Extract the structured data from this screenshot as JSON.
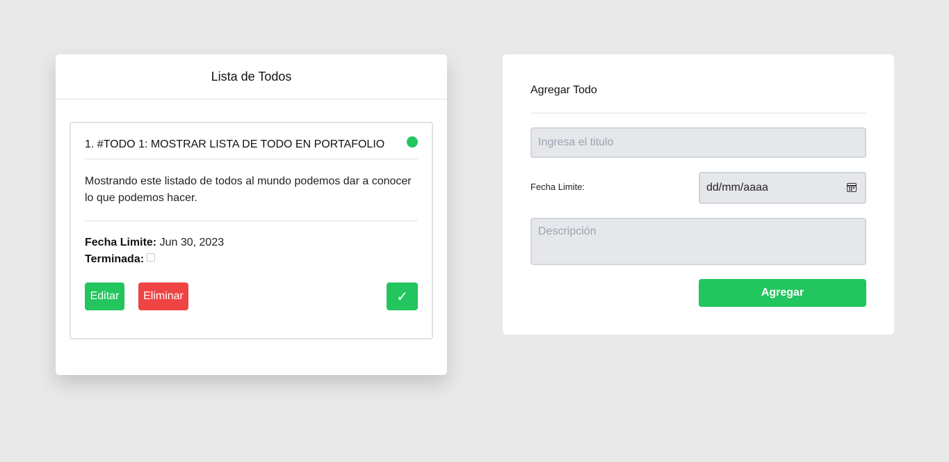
{
  "list_panel": {
    "title": "Lista de Todos",
    "todos": [
      {
        "title": "1. #TODO 1: MOSTRAR LISTA DE TODO EN PORTAFOLIO",
        "description": "Mostrando este listado de todos al mundo podemos dar a conocer lo que podemos hacer.",
        "due_label": "Fecha Limite:",
        "due_value": "Jun 30, 2023",
        "done_label": "Terminada:",
        "done": false,
        "status_color": "#22c55e",
        "edit_label": "Editar",
        "delete_label": "Eliminar",
        "complete_label": "✓"
      }
    ]
  },
  "form_panel": {
    "title": "Agregar Todo",
    "title_placeholder": "Ingresa el titulo",
    "date_label": "Fecha Limite:",
    "date_placeholder": "dd/mm/aaaa",
    "description_placeholder": "Descripción",
    "submit_label": "Agregar"
  },
  "colors": {
    "accent": "#22c55e",
    "danger": "#ef4444",
    "background": "#e9e9e9"
  }
}
